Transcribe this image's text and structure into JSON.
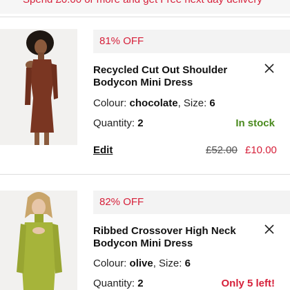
{
  "banner": {
    "text": "Spend £0.00 or more and get Free next day delivery"
  },
  "colors": {
    "accent_red": "#d6203a",
    "in_stock_green": "#4a8a1e",
    "low_stock_red": "#d6203a",
    "banner_bg": "#f6f6f6"
  },
  "items": [
    {
      "discount": "81% OFF",
      "title": "Recycled Cut Out Shoulder Bodycon Mini Dress",
      "colour_label": "Colour: ",
      "colour_value": "chocolate",
      "size_label": ", Size: ",
      "size_value": "6",
      "quantity_label": "Quantity: ",
      "quantity_value": "2",
      "stock_status": "In stock",
      "edit_label": "Edit",
      "old_price": "£52.00",
      "new_price": "£10.00",
      "image_icon": "product-photo-chocolate-dress"
    },
    {
      "discount": "82% OFF",
      "title": "Ribbed Crossover High Neck Bodycon Mini Dress",
      "colour_label": "Colour: ",
      "colour_value": "olive",
      "size_label": ", Size: ",
      "size_value": "6",
      "quantity_label": "Quantity: ",
      "quantity_value": "2",
      "stock_status": "Only 5 left!",
      "image_icon": "product-photo-olive-dress"
    }
  ]
}
